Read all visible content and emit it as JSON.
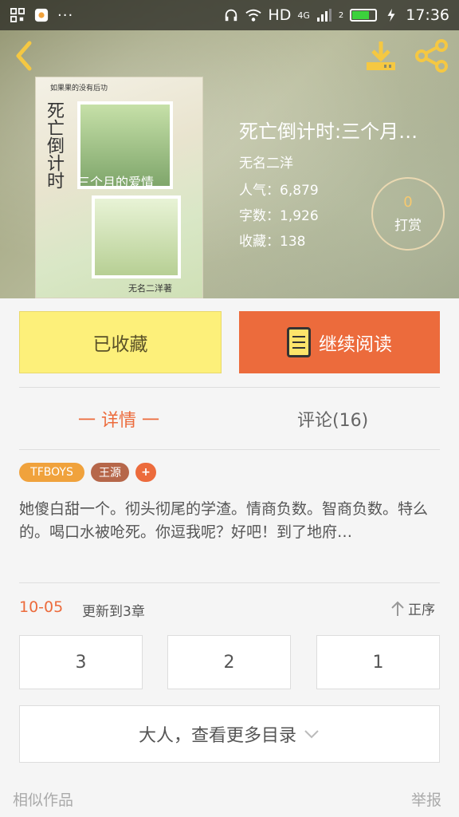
{
  "status_bar": {
    "network": "HD",
    "signal_label": "4G",
    "sim": "2",
    "time": "17:36",
    "battery_level": 0.75
  },
  "header": {
    "back_icon": "chevron-left-icon",
    "download_icon": "download-icon",
    "share_icon": "share-icon"
  },
  "book": {
    "title": "死亡倒计时:三个月…",
    "author": "无名二洋",
    "popularity": "人气：6,879",
    "word_count": "字数：1,926",
    "favorites": "收藏：138",
    "cover_text": {
      "top_note": "如果果的没有后功",
      "title_vertical": "死亡倒计时",
      "subtitle": "三个月的爱情",
      "author_sig": "无名二洋著"
    }
  },
  "tip": {
    "count": "0",
    "label": "打赏"
  },
  "actions": {
    "collect_label": "已收藏",
    "read_label": "继续阅读"
  },
  "tabs": {
    "detail": "一 详情 一",
    "comments": "评论(16)"
  },
  "tags": [
    "TFBOYS",
    "王源",
    "+"
  ],
  "summary": "她傻白甜一个。彻头彻尾的学渣。情商负数。智商负数。特么的。喝口水被呛死。你逗我呢？好吧！到了地府…",
  "update": {
    "date": "10-05",
    "text": "更新到3章",
    "sort_label": "正序"
  },
  "chapters": [
    "3",
    "2",
    "1"
  ],
  "more_label": "大人，查看更多目录",
  "footer": {
    "similar": "相似作品",
    "report": "举报"
  },
  "colors": {
    "accent": "#ec6b3c",
    "collect_bg": "#fdf07a",
    "tag_tfboys": "#f0a23c",
    "tag_wangyuan": "#b6674a"
  }
}
